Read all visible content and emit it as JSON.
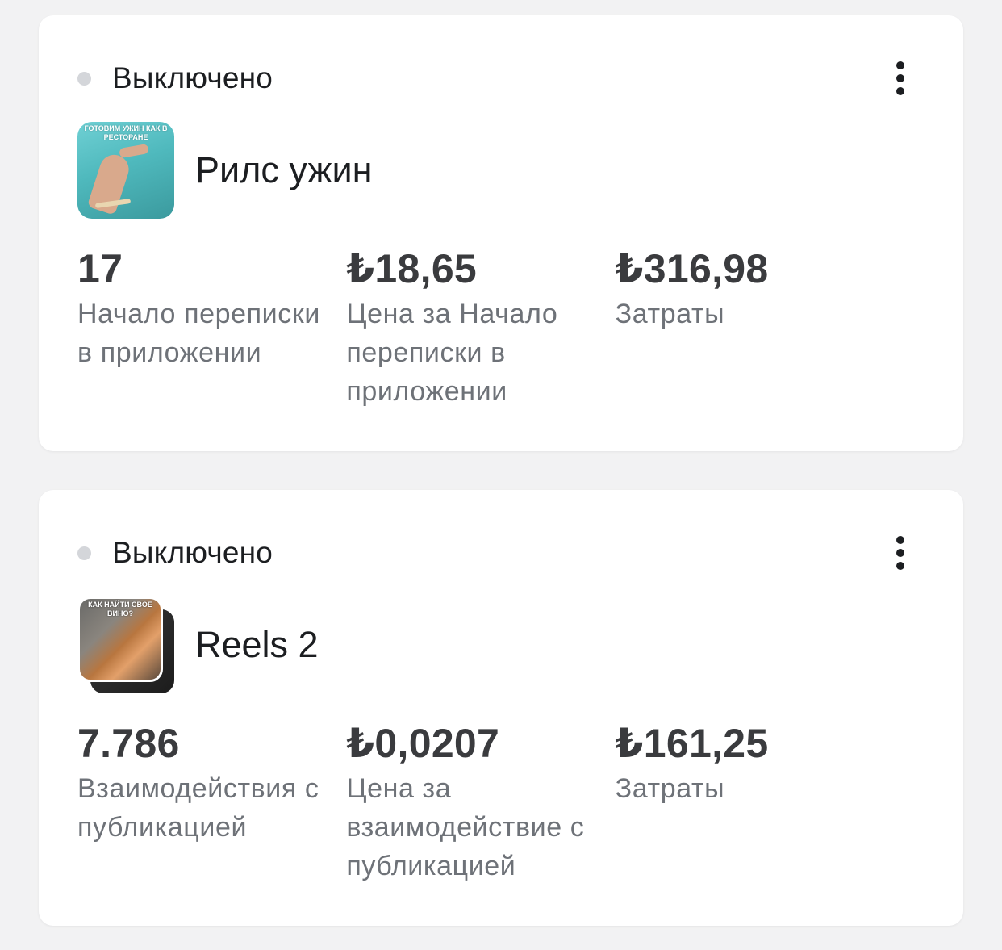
{
  "colors": {
    "status_dot_off": "#d4d6da",
    "primary_text": "#1c1e21",
    "metric_value": "#3a3b3e",
    "metric_label": "#6e7278",
    "card_background": "#ffffff",
    "page_background": "#f2f2f3"
  },
  "ads": [
    {
      "status": "Выключено",
      "more_icon": "more-vertical-icon",
      "thumbnail_caption": "ГОТОВИМ УЖИН КАК В РЕСТОРАНЕ",
      "name": "Рилс ужин",
      "metrics": [
        {
          "value": "17",
          "label": "Начало переписки в приложении"
        },
        {
          "value": "₺18,65",
          "label": "Цена за Начало переписки в приложении"
        },
        {
          "value": "₺316,98",
          "label": "Затраты"
        }
      ]
    },
    {
      "status": "Выключено",
      "more_icon": "more-vertical-icon",
      "thumbnail_caption": "КАК НАЙТИ СВОЕ ВИНО?",
      "name": "Reels 2",
      "metrics": [
        {
          "value": "7.786",
          "label": "Взаимодействия с публикацией"
        },
        {
          "value": "₺0,0207",
          "label": "Цена за взаимодействие с публикацией"
        },
        {
          "value": "₺161,25",
          "label": "Затраты"
        }
      ]
    }
  ]
}
